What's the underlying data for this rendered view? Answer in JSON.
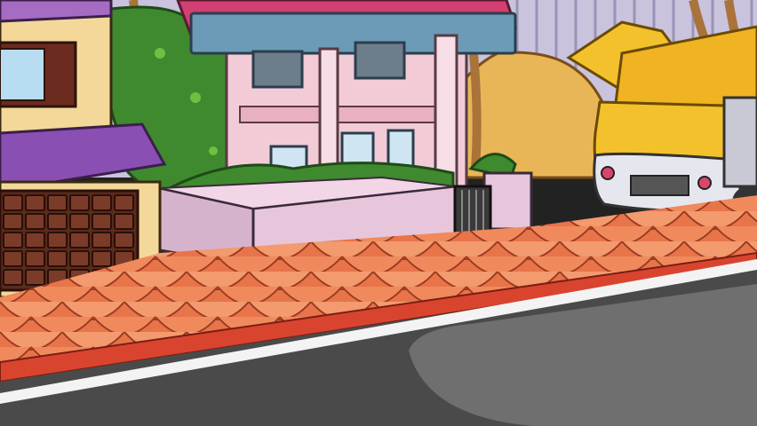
{
  "scene": {
    "type": "cartoon-street-background",
    "elements": [
      "brick-house-left",
      "garage-door",
      "green-tree",
      "pink-two-story-house",
      "hedge-planter",
      "small-iron-gate",
      "sand-pile",
      "corrugated-fence",
      "palm-trunks",
      "yellow-truck-hood-open",
      "tiled-sidewalk",
      "asphalt-road"
    ]
  },
  "colors": {
    "sky_fence": "#c9c3dd",
    "sand": "#e9b657",
    "roof_magenta": "#d23f73",
    "roof_purple": "#8a4fb3",
    "house_pink": "#f2cbd6",
    "wall_planter": "#e7c6dc",
    "hedge_green": "#3f8a2e",
    "tile_orange": "#f08a5c",
    "tile_dark": "#c9583a",
    "curb_red": "#d9442f",
    "road": "#4a4a4a",
    "road_light": "#6f6f6f",
    "truck_yellow": "#f3c12b",
    "brick_wall": "#f3d89a",
    "garage_brown": "#5a2a1d"
  }
}
